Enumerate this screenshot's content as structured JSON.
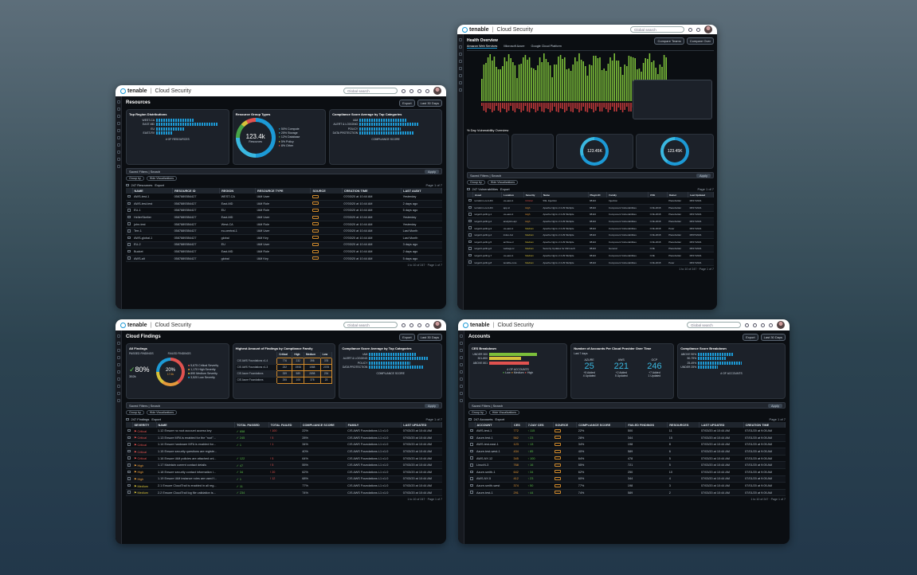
{
  "app": {
    "brand": "tenable",
    "product": "Cloud Security",
    "search": "Global search",
    "export": "Export",
    "period": "Last 30 Days",
    "saved_filters": "Saved Filters",
    "search_box": "Search",
    "apply": "Apply",
    "group_by": "Group by",
    "hide_viz": "Hide Visualizations",
    "page": "Page 1 of 7",
    "rows_info": "1 to 10 of 247"
  },
  "resources": {
    "title": "Resources",
    "count": "247 Resources",
    "top_region": {
      "title": "Top Region Distributions",
      "labels": [
        "WEST-CA",
        "EAST-MD",
        "EU",
        "EAST-RV"
      ],
      "axis": "# OF RESOURCES",
      "ticks": [
        "0",
        "10",
        "20",
        "30",
        "40",
        "50",
        "60",
        "70"
      ]
    },
    "group_types": {
      "title": "Resource Group Types",
      "center": "123.4k",
      "sub": "Resources",
      "items": [
        {
          "pct": "50%",
          "label": "Compute"
        },
        {
          "pct": "25%",
          "label": "Storage"
        },
        {
          "pct": "12%",
          "label": "Database"
        },
        {
          "pct": "5%",
          "label": "Policy"
        },
        {
          "pct": "8%",
          "label": "Other"
        }
      ]
    },
    "compliance": {
      "title": "Compliance Score Average by Top Categories",
      "labels": [
        "IAM",
        "ALERT & LOGGING",
        "POLICY",
        "DATA PROTECTION"
      ],
      "axis": "COMPLIANCE SCORE",
      "ticks": [
        "0%",
        "20%",
        "40%",
        "60%",
        "80%",
        "100%"
      ]
    },
    "columns": [
      "NAME",
      "RESOURCE ID",
      "REGION",
      "RESOURCE TYPE",
      "SOURCE",
      "CREATION TIME",
      "LAST AUDIT"
    ],
    "rows": [
      [
        "AWS-test-1",
        "05878893B4427",
        "WEST-CA",
        "IAM User",
        "07/03/20 at 10:44 AM",
        "Yesterday"
      ],
      [
        "AWS-test-test",
        "05878893B4427",
        "East-MD",
        "IAM Role",
        "07/03/20 at 10:44 AM",
        "2 days ago"
      ],
      [
        "EU-1",
        "05878893B4427",
        "EU",
        "IAM Role",
        "07/03/20 at 10:44 AM",
        "5 days ago"
      ],
      [
        "HelterSkelter",
        "05878893B4427",
        "East-MD",
        "IAM User",
        "07/03/20 at 10:44 AM",
        "Yesterday"
      ],
      [
        "john-test",
        "05878893B4427",
        "West-CA",
        "IAM Role",
        "07/03/20 at 10:44 AM",
        "Yesterday"
      ],
      [
        "Terr-1",
        "05878893B4427",
        "eu-central-1",
        "IAM User",
        "07/03/20 at 10:44 AM",
        "Last Month"
      ],
      [
        "AWS-global-1",
        "05878893B4427",
        "global",
        "IAM Key",
        "07/03/20 at 10:44 AM",
        "Last Month"
      ],
      [
        "EU-2",
        "05878893B4427",
        "EU",
        "IAM User",
        "07/03/20 at 10:44 AM",
        "3 days ago"
      ],
      [
        "Bucket",
        "05878893B4427",
        "East-MD",
        "IAM Role",
        "07/03/20 at 10:44 AM",
        "2 days ago"
      ],
      [
        "AWS-alt",
        "05878893B4427",
        "global",
        "IAM Key",
        "07/03/20 at 10:44 AM",
        "5 days ago"
      ]
    ]
  },
  "health": {
    "title": "Health Overview",
    "tabs": [
      "Amazon Web Services",
      "Microsoft Azure",
      "Google Cloud Platform"
    ],
    "compare1": "Compare Teams",
    "compare2": "Compare Over",
    "vuln_title": "% Day Vulnerability Overview",
    "center": "123.45K",
    "center2": "123.45K",
    "count": "247 Vulnerabilities",
    "columns": [
      "Asset",
      "Location",
      "Severity",
      "Name",
      "Plugin ID",
      "Family",
      "CVE",
      "Owner",
      "Last Updated"
    ],
    "rows": [
      [
        "terraform-cert-4th",
        "us-east-1",
        "Critical",
        "SSL Injection",
        "98110",
        "Injection",
        "",
        "Placeholder",
        "08/17/2021"
      ],
      [
        "terraform-cert-4th",
        "app-tc",
        "High",
        "Apache Nginx 2.4.29 Multiple",
        "98110",
        "Component Vulnerabilities",
        "CVE-2018",
        "Placeholder",
        "08/17/2021"
      ],
      [
        "target3-polling-1",
        "us-east-1",
        "High",
        "Apache Nginx 2.4.29 Multiple",
        "98110",
        "Component Vulnerabilities",
        "CVE-2018",
        "Placeholder",
        "08/17/2021"
      ],
      [
        "target3-polling-2",
        "analytics-api",
        "High",
        "Apache Nginx 2.4.29 Multiple",
        "98110",
        "Component Vulnerabilities",
        "CVE-2018",
        "Placeholder",
        "08/17/2021"
      ],
      [
        "target3-polling-3",
        "us-east-1",
        "Medium",
        "Apache Nginx 2.4.29 Multiple",
        "98110",
        "Component Vulnerabilities",
        "CVE-2018",
        "Peter",
        "08/17/2021"
      ],
      [
        "target3-polling-4",
        "index-1st",
        "Medium",
        "Apache Nginx 2.4.29 Multiple",
        "98110",
        "Component Vulnerabilities",
        "CVE-2018",
        "Placeholder",
        "08/07/2021"
      ],
      [
        "target3-polling-5",
        "archive-rc",
        "Medium",
        "Apache Nginx 2.4.29 Multiple",
        "98110",
        "Component Vulnerabilities",
        "CVE-2018",
        "Placeholder",
        "08/17/2021"
      ],
      [
        "target3-polling-6",
        "webapp-tc",
        "Medium",
        "Security Updates for Microsoft",
        "98110",
        "General",
        "CVE",
        "Placeholder",
        "08/17/2021"
      ],
      [
        "target3-polling-7",
        "us-east-1",
        "Medium",
        "Apache Nginx 2.4.29 Multiple",
        "98110",
        "Component Vulnerabilities",
        "CVE",
        "Placeholder",
        "08/17/2021"
      ],
      [
        "target3-polling-8",
        "tenable-core",
        "Medium",
        "Apache Nginx 2.4.29 Multiple",
        "98110",
        "Component Vulnerabilities",
        "CVE-2018",
        "Peter",
        "08/17/2021"
      ]
    ]
  },
  "findings": {
    "title": "Cloud Findings",
    "count": "247 Findings",
    "all": {
      "title": "All Findings",
      "passed": "PASSED FINDINGS",
      "failed": "FAILED FINDINGS",
      "pass_pct": "80%",
      "pass_n": "352k",
      "fail_pct": "20%",
      "fail_n": "17.6k",
      "sev": [
        {
          "n": "5,675",
          "l": "Critical Severity"
        },
        {
          "n": "1,170",
          "l": "High Severity"
        },
        {
          "n": "890",
          "l": "Medium Severity"
        },
        {
          "n": "3,520",
          "l": "Low Severity"
        }
      ]
    },
    "family": {
      "title": "Highest Amount of Findings by Compliance Family",
      "cols": [
        "Critical",
        "High",
        "Medium",
        "Low"
      ],
      "rows": [
        [
          "CIS AWS Foundations v1.4",
          "776",
          "232",
          "398",
          "378"
        ],
        [
          "CIS AWS Foundations v1.3",
          "232",
          "1908",
          "1588",
          "2378"
        ],
        [
          "CIS Azure Foundations",
          "339",
          "589",
          "2898",
          "234"
        ],
        [
          "CIS Azure Foundations",
          "255",
          "105",
          "378",
          "23"
        ]
      ]
    },
    "compliance": {
      "title": "Compliance Score Average by Top Categories",
      "labels": [
        "IAM",
        "ALERT & LOGGING",
        "POLICY",
        "DATA PROTECTION"
      ],
      "axis": "COMPLIANCE SCORE"
    },
    "columns": [
      "SEVERITY",
      "NAME",
      "TOTAL PASSED",
      "TOTAL FAILED",
      "COMPLIANCE SCORE",
      "FAMILY",
      "LAST UPDATED"
    ],
    "rows": [
      [
        "Critical",
        "1.12 Ensure no root account access key",
        "658",
        "100",
        "22%",
        "CIS AWS Foundations L1 v1.0",
        "07/03/20 at 10:44 AM"
      ],
      [
        "Critical",
        "1.13 Ensure MFA is enabled for the \"root\"...",
        "245",
        "5",
        "28%",
        "CIS AWS Foundations L1 v1.0",
        "07/03/20 at 10:44 AM"
      ],
      [
        "Critical",
        "1.14 Ensure hardware MFA is enabled for...",
        "1",
        "1",
        "34%",
        "CIS AWS Foundations L1 v1.0",
        "07/03/20 at 10:44 AM"
      ],
      [
        "Critical",
        "1.15 Ensure security questions are registe...",
        "",
        "",
        "40%",
        "CIS AWS Foundations L1 v1.0",
        "07/03/20 at 10:44 AM"
      ],
      [
        "Critical",
        "1.16 Ensure IAM policies are attached onl...",
        "122",
        "5",
        "64%",
        "CIS AWS Foundations L1 v1.0",
        "07/03/20 at 10:44 AM"
      ],
      [
        "High",
        "1.17 Maintain current contact details",
        "47",
        "5",
        "55%",
        "CIS AWS Foundations L1 v1.0",
        "07/03/20 at 10:44 AM"
      ],
      [
        "High",
        "1.18 Ensure security contact information i...",
        "34",
        "20",
        "62%",
        "CIS AWS Foundations L1 v1.0",
        "07/03/20 at 10:44 AM"
      ],
      [
        "High",
        "1.19 Ensure IAM instance roles are used f...",
        "1",
        "12",
        "68%",
        "CIS AWS Foundations L1 v1.0",
        "07/03/20 at 10:44 AM"
      ],
      [
        "Medium",
        "2.1 Ensure CloudTrail is enabled in all reg...",
        "11",
        "",
        "77%",
        "CIS AWS Foundations L1 v1.0",
        "07/03/20 at 10:44 AM"
      ],
      [
        "Medium",
        "2.2 Ensure CloudTrail log file validation is...",
        "234",
        "",
        "74%",
        "CIS AWS Foundations L1 v1.0",
        "07/03/20 at 10:44 AM"
      ]
    ]
  },
  "accounts": {
    "title": "Accounts",
    "count": "247 Accounts",
    "ces": {
      "title": "CES Breakdown",
      "labels": [
        "UNDER 300",
        "301-800",
        "ABOVE 801"
      ],
      "axis": "# OF ACCOUNTS",
      "legend": [
        "Low",
        "Medium",
        "High"
      ]
    },
    "provider": {
      "title": "Number of Accounts Per Cloud Provider Over Time",
      "sub": "Last 7 days",
      "cols": [
        {
          "name": "AZURE",
          "n": "25",
          "a": "+5 Added",
          "b": "4 Updated"
        },
        {
          "name": "AWS",
          "n": "221",
          "a": "+2 Added",
          "b": "5 Updated"
        },
        {
          "name": "GCP",
          "n": "246",
          "a": "+7 Added",
          "b": "1 Updated"
        }
      ]
    },
    "comp": {
      "title": "Compliance Score Breakdown",
      "labels": [
        "ABOVE 90%",
        "50-79%",
        "25-49%",
        "UNDER 25%"
      ],
      "axis": "# OF ACCOUNTS"
    },
    "columns": [
      "ACCOUNT",
      "CES",
      "7-DAY CES",
      "SOURCE",
      "COMPLIANCE SCORE",
      "FAILED FINDINGS",
      "RESOURCES",
      "LAST UPDATED",
      "CREATION TIME"
    ],
    "rows": [
      [
        "AWS-test-1",
        "772",
        "115",
        "22%",
        "500",
        "11",
        "07/03/20 at 10:44 AM",
        "07/01/20 at 9:05 AM"
      ],
      [
        "Azure-test-1",
        "562",
        "23",
        "28%",
        "344",
        "15",
        "07/03/20 at 10:44 AM",
        "07/01/20 at 9:05 AM"
      ],
      [
        "AWS-test-east-1",
        "123",
        "13",
        "34%",
        "198",
        "8",
        "07/03/20 at 10:44 AM",
        "07/01/20 at 9:05 AM"
      ],
      [
        "Azure-test-west-1",
        "434",
        "85",
        "40%",
        "589",
        "6",
        "07/03/20 at 10:44 AM",
        "07/01/20 at 9:05 AM"
      ],
      [
        "AWS-NY-12",
        "345",
        "100",
        "64%",
        "478",
        "5",
        "07/03/20 at 10:44 AM",
        "07/01/20 at 9:05 AM"
      ],
      [
        "LinuxN-3",
        "768",
        "16",
        "55%",
        "721",
        "5",
        "07/03/20 at 10:44 AM",
        "07/01/20 at 9:05 AM"
      ],
      [
        "Azure-smith-1",
        "642",
        "34",
        "62%",
        "250",
        "10",
        "07/03/20 at 10:44 AM",
        "07/01/20 at 9:05 AM"
      ],
      [
        "AWS-NY-5",
        "412",
        "23",
        "60%",
        "344",
        "4",
        "07/03/20 at 10:44 AM",
        "07/01/20 at 9:05 AM"
      ],
      [
        "Azure-smith-west",
        "374",
        "50",
        "77%",
        "198",
        "3",
        "07/03/20 at 10:44 AM",
        "07/01/20 at 9:05 AM"
      ],
      [
        "Azure-test-1",
        "291",
        "44",
        "74%",
        "589",
        "2",
        "07/03/20 at 10:44 AM",
        "07/01/20 at 9:05 AM"
      ]
    ]
  }
}
